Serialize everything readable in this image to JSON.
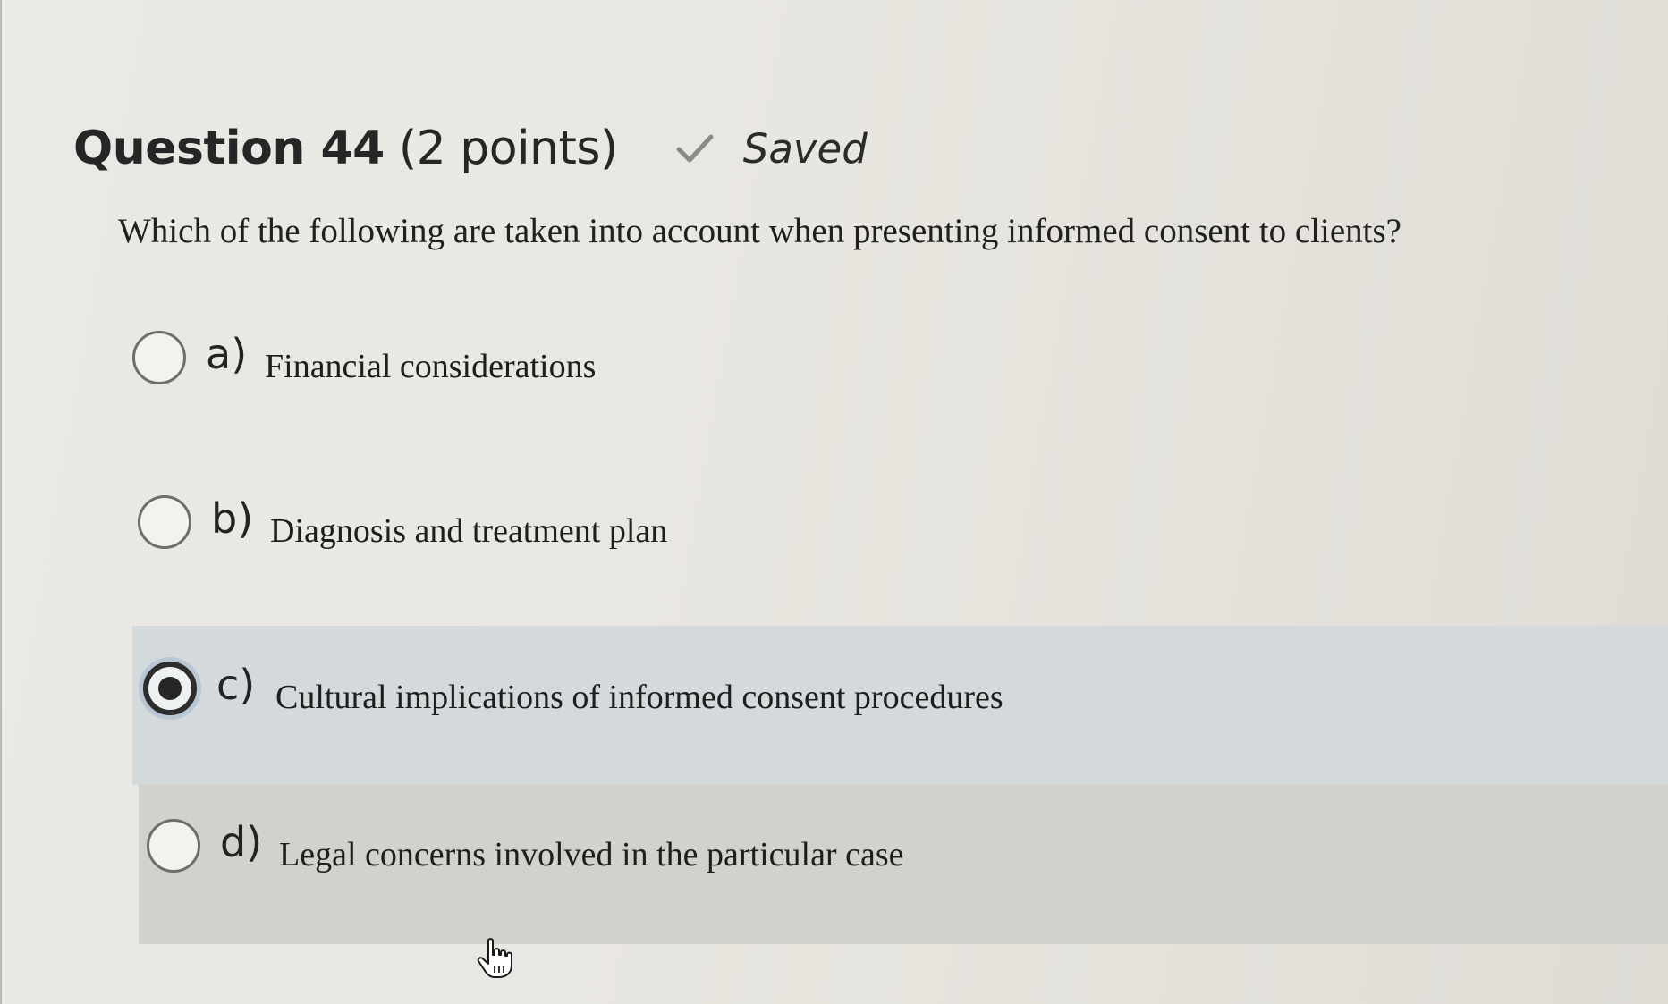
{
  "question": {
    "title_bold": "Question 44",
    "title_points": " (2 points)",
    "status_label": "Saved",
    "status_icon": "check-icon",
    "prompt": "Which of the following are taken into account when presenting informed consent to clients?"
  },
  "options": [
    {
      "letter": "a)",
      "text": "Financial considerations",
      "selected": false
    },
    {
      "letter": "b)",
      "text": "Diagnosis and treatment plan",
      "selected": false
    },
    {
      "letter": "c)",
      "text": "Cultural implications of informed consent procedures",
      "selected": true
    },
    {
      "letter": "d)",
      "text": "Legal concerns involved in the particular case",
      "selected": false
    }
  ],
  "colors": {
    "background": "#e9e7e1",
    "selected_band": "#d4d9dc",
    "hover_band": "#d3d1cb",
    "check": "#8a8a8a"
  },
  "cursor_icon": "hand-pointer-icon"
}
